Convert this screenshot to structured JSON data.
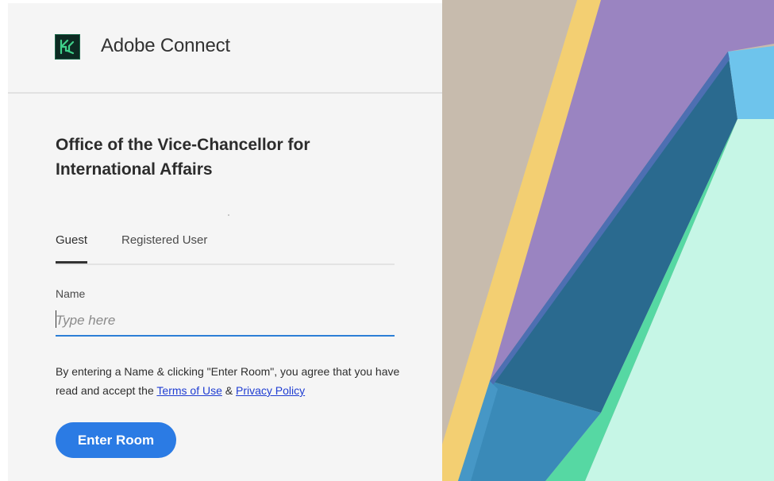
{
  "app": {
    "name": "Adobe Connect"
  },
  "room": {
    "title": "Office of the Vice-Chancellor for International Affairs"
  },
  "tabs": [
    {
      "label": "Guest",
      "active": true
    },
    {
      "label": "Registered User",
      "active": false
    }
  ],
  "name_field": {
    "label": "Name",
    "placeholder": "Type here",
    "value": ""
  },
  "agreement": {
    "text_before": "By entering a Name & clicking \"Enter Room\", you agree that you have read and accept the ",
    "terms_link": "Terms of Use",
    "separator": " & ",
    "privacy_link": "Privacy Policy"
  },
  "enter_button": {
    "label": "Enter Room"
  },
  "colors": {
    "accent": "#2b7be4",
    "link": "#1f3dd2",
    "input_underline": "#2c7fd6",
    "panel_bg": "#f5f5f5"
  },
  "icons": {
    "logo": "adobe-connect-logo-icon"
  }
}
